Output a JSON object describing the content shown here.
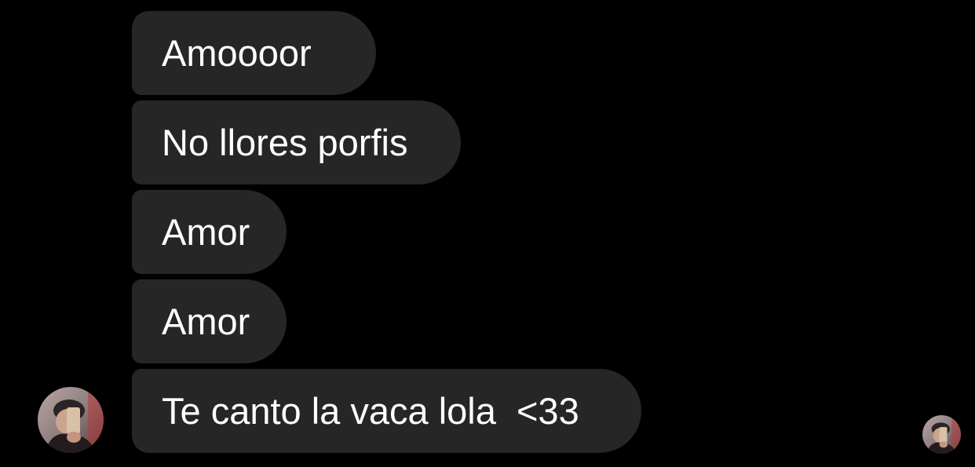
{
  "conversation": {
    "messages": [
      {
        "text": "Amoooor"
      },
      {
        "text": "No llores porfis"
      },
      {
        "text": "Amor"
      },
      {
        "text": "Amor"
      },
      {
        "text": "Te canto la vaca lola  <33"
      }
    ]
  },
  "sender_avatar": {
    "icon": "profile-photo"
  },
  "seen_avatar": {
    "icon": "profile-photo"
  },
  "colors": {
    "background": "#000000",
    "bubble": "#262626",
    "text": "#ffffff"
  }
}
